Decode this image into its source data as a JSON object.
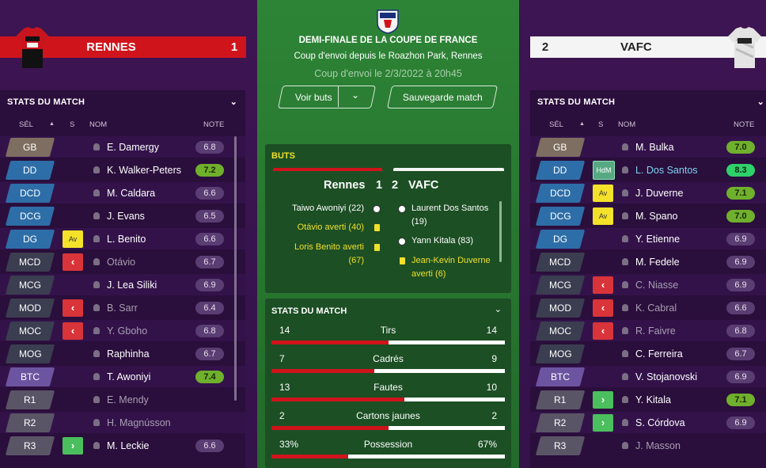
{
  "home": {
    "name": "RENNES",
    "score": "1"
  },
  "away": {
    "name": "VAFC",
    "score": "2"
  },
  "match": {
    "competition": "DEMI-FINALE DE LA COUPE DE FRANCE",
    "venue": "Coup d'envoi depuis le Roazhon Park, Rennes",
    "kickoff": "Coup d'envoi le 2/3/2022 à 20h45",
    "btn_goals": "Voir buts",
    "btn_save": "Sauvegarde match"
  },
  "goals_card": {
    "title": "BUTS",
    "home_name": "Rennes",
    "home_score": "1",
    "away_score": "2",
    "away_name": "VAFC",
    "home_events": [
      {
        "text": "Taiwo Awoniyi (22)",
        "type": "goal"
      },
      {
        "text": "Otávio averti (40)",
        "type": "yellow"
      },
      {
        "text": "Loris Benito averti (67)",
        "type": "yellow"
      }
    ],
    "away_events": [
      {
        "text": "Laurent Dos Santos (19)",
        "type": "goal"
      },
      {
        "text": "Yann Kitala (83)",
        "type": "goal"
      },
      {
        "text": "Jean-Kevin Duverne averti (6)",
        "type": "yellow"
      }
    ]
  },
  "stats_card": {
    "title": "STATS DU MATCH",
    "rows": [
      {
        "label": "Tirs",
        "home": "14",
        "away": "14",
        "home_share": 0.5
      },
      {
        "label": "Cadrés",
        "home": "7",
        "away": "9",
        "home_share": 0.44
      },
      {
        "label": "Fautes",
        "home": "13",
        "away": "10",
        "home_share": 0.57
      },
      {
        "label": "Cartons jaunes",
        "home": "2",
        "away": "2",
        "home_share": 0.5
      },
      {
        "label": "Possession",
        "home": "33%",
        "away": "67%",
        "home_share": 0.33
      }
    ]
  },
  "left_panel": {
    "title": "STATS DU MATCH",
    "headers": {
      "sel": "SÉL",
      "s": "S",
      "nom": "NOM",
      "note": "NOTE"
    },
    "players": [
      {
        "pos": "GB",
        "cat": "gk",
        "name": "E. Damergy",
        "rating": "6.8",
        "rclass": "norm",
        "badge": "",
        "dim": false
      },
      {
        "pos": "DD",
        "cat": "def",
        "name": "K. Walker-Peters",
        "rating": "7.2",
        "rclass": "good",
        "badge": "",
        "dim": false
      },
      {
        "pos": "DCD",
        "cat": "def",
        "name": "M. Caldara",
        "rating": "6.6",
        "rclass": "norm",
        "badge": "",
        "dim": false
      },
      {
        "pos": "DCG",
        "cat": "def",
        "name": "J. Evans",
        "rating": "6.5",
        "rclass": "norm",
        "badge": "",
        "dim": false
      },
      {
        "pos": "DG",
        "cat": "def",
        "name": "L. Benito",
        "rating": "6.6",
        "rclass": "norm",
        "badge": "Av",
        "dim": false
      },
      {
        "pos": "MCD",
        "cat": "mid",
        "name": "Otávio",
        "rating": "6.7",
        "rclass": "norm",
        "badge": "out",
        "dim": true
      },
      {
        "pos": "MCG",
        "cat": "mid",
        "name": "J. Lea Siliki",
        "rating": "6.9",
        "rclass": "norm",
        "badge": "",
        "dim": false
      },
      {
        "pos": "MOD",
        "cat": "mid",
        "name": "B. Sarr",
        "rating": "6.4",
        "rclass": "norm",
        "badge": "out",
        "dim": true
      },
      {
        "pos": "MOC",
        "cat": "mid",
        "name": "Y. Gboho",
        "rating": "6.8",
        "rclass": "norm",
        "badge": "out",
        "dim": true
      },
      {
        "pos": "MOG",
        "cat": "mid",
        "name": "Raphinha",
        "rating": "6.7",
        "rclass": "norm",
        "badge": "",
        "dim": false
      },
      {
        "pos": "BTC",
        "cat": "att",
        "name": "T. Awoniyi",
        "rating": "7.4",
        "rclass": "good",
        "badge": "",
        "dim": false
      },
      {
        "pos": "R1",
        "cat": "sub",
        "name": "E. Mendy",
        "rating": "",
        "rclass": "",
        "badge": "",
        "dim": true
      },
      {
        "pos": "R2",
        "cat": "sub",
        "name": "H. Magnússon",
        "rating": "",
        "rclass": "",
        "badge": "",
        "dim": true
      },
      {
        "pos": "R3",
        "cat": "sub",
        "name": "M. Leckie",
        "rating": "6.6",
        "rclass": "norm",
        "badge": "in",
        "dim": false
      }
    ]
  },
  "right_panel": {
    "title": "STATS DU MATCH",
    "headers": {
      "sel": "SÉL",
      "s": "S",
      "nom": "NOM",
      "note": "NOTE"
    },
    "players": [
      {
        "pos": "GB",
        "cat": "gk",
        "name": "M. Bulka",
        "rating": "7.0",
        "rclass": "good",
        "badge": "",
        "dim": false
      },
      {
        "pos": "DD",
        "cat": "def",
        "name": "L. Dos Santos",
        "rating": "8.3",
        "rclass": "great",
        "badge": "HdM",
        "dim": false,
        "hl": true
      },
      {
        "pos": "DCD",
        "cat": "def",
        "name": "J. Duverne",
        "rating": "7.1",
        "rclass": "good",
        "badge": "Av",
        "dim": false
      },
      {
        "pos": "DCG",
        "cat": "def",
        "name": "M. Spano",
        "rating": "7.0",
        "rclass": "good",
        "badge": "Av",
        "dim": false
      },
      {
        "pos": "DG",
        "cat": "def",
        "name": "Y. Etienne",
        "rating": "6.9",
        "rclass": "norm",
        "badge": "",
        "dim": false
      },
      {
        "pos": "MCD",
        "cat": "mid",
        "name": "M. Fedele",
        "rating": "6.9",
        "rclass": "norm",
        "badge": "",
        "dim": false
      },
      {
        "pos": "MCG",
        "cat": "mid",
        "name": "C. Niasse",
        "rating": "6.9",
        "rclass": "norm",
        "badge": "out",
        "dim": true
      },
      {
        "pos": "MOD",
        "cat": "mid",
        "name": "K. Cabral",
        "rating": "6.6",
        "rclass": "norm",
        "badge": "out",
        "dim": true
      },
      {
        "pos": "MOC",
        "cat": "mid",
        "name": "R. Faivre",
        "rating": "6.8",
        "rclass": "norm",
        "badge": "out",
        "dim": true
      },
      {
        "pos": "MOG",
        "cat": "mid",
        "name": "C. Ferreira",
        "rating": "6.7",
        "rclass": "norm",
        "badge": "",
        "dim": false
      },
      {
        "pos": "BTC",
        "cat": "att",
        "name": "V. Stojanovski",
        "rating": "6.9",
        "rclass": "norm",
        "badge": "",
        "dim": false
      },
      {
        "pos": "R1",
        "cat": "sub",
        "name": "Y. Kitala",
        "rating": "7.1",
        "rclass": "good",
        "badge": "in",
        "dim": false
      },
      {
        "pos": "R2",
        "cat": "sub",
        "name": "S. Córdova",
        "rating": "6.9",
        "rclass": "norm",
        "badge": "in",
        "dim": false
      },
      {
        "pos": "R3",
        "cat": "sub",
        "name": "J. Masson",
        "rating": "",
        "rclass": "",
        "badge": "",
        "dim": true
      }
    ]
  },
  "colors": {
    "home": "#d0141c",
    "pitch": "#2a7a32",
    "card": "#f0e02a",
    "sub_in": "#4bbf5d",
    "sub_out": "#d9343a"
  }
}
